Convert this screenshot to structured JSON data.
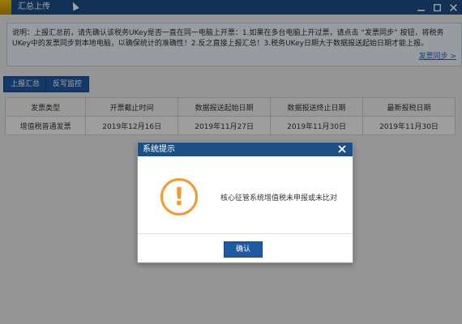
{
  "window": {
    "title": "汇总上传",
    "controls": [
      "minimize-icon",
      "maximize-icon",
      "close-icon"
    ],
    "colors": {
      "titlebar": "#1b4f86",
      "accent": "#1f5aa3",
      "warning": "#f29a2e"
    }
  },
  "notice": {
    "text": "说明：上报汇总前，请先确认该税务UKey是否一直在同一电脑上开票：1.如果在多台电脑上开过票，请点击 “发票同步” 按钮，将税务UKey中的发票同步到本地电脑，以确保统计的准确性！2.反之直接上报汇总！3.税务UKey日期大于数据报送起始日期才能上报。",
    "link": "发票同步 >"
  },
  "toolbar": {
    "upload_label": "上报汇总",
    "monitor_label": "反写监控"
  },
  "table": {
    "headers": [
      "发票类型",
      "开票截止时间",
      "数据报送起始日期",
      "数据报送终止日期",
      "最新报税日期"
    ],
    "rows": [
      [
        "增值税普通发票",
        "2019年12月16日",
        "2019年11月27日",
        "2019年11月30日",
        "2019年11月30日"
      ]
    ]
  },
  "dialog": {
    "title": "系统提示",
    "message": "核心征管系统增值税未申报或未比对",
    "ok_label": "确认"
  }
}
